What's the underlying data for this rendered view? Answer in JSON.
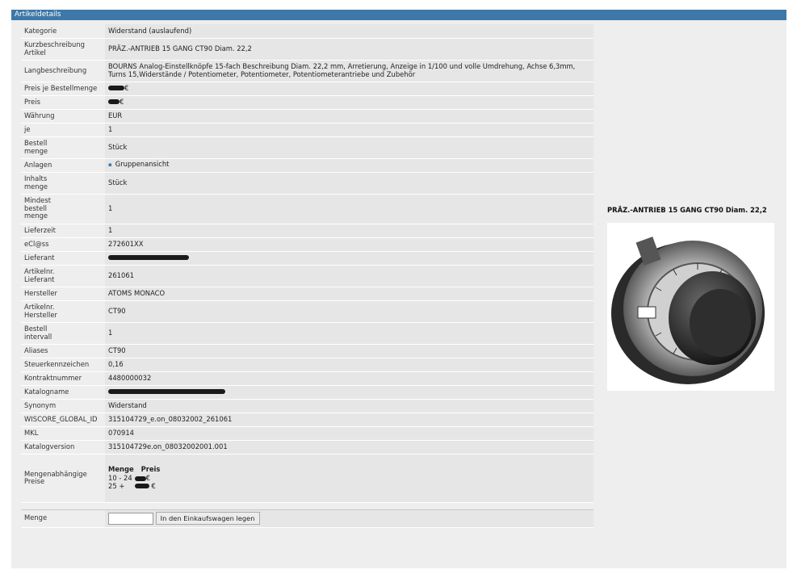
{
  "panel_title": "Artikeldetails",
  "rows": [
    {
      "label": "Kategorie",
      "value": "Widerstand (auslaufend)",
      "h": 17
    },
    {
      "label": "Kurzbeschreibung\nArtikel",
      "value": "PRÄZ.-ANTRIEB 15 GANG CT90 Diam. 22,2",
      "h": 27
    },
    {
      "label": "Langbeschreibung",
      "value": "BOURNS Analog-Einstellknöpfe 15-fach Beschreibung Diam. 22,2 mm, Arretierung, Anzeige in 1/100 und volle Umdrehung, Achse 6,3mm, Turns 15,Widerstände / Potentiometer, Potentiometer, Potentiometerantriebe und Zubehör",
      "h": 27
    },
    {
      "label": "Preis je Bestellmenge",
      "value": "€",
      "redact": "p1",
      "h": 17
    },
    {
      "label": "Preis",
      "value": "€",
      "redact": "p2",
      "h": 17
    },
    {
      "label": "Währung",
      "value": "EUR",
      "h": 17
    },
    {
      "label": "je",
      "value": "1",
      "h": 17
    },
    {
      "label": "Bestell\nmenge",
      "value": "Stück",
      "h": 27
    },
    {
      "label": "Anlagen",
      "value": "Gruppenansicht",
      "bullet": true,
      "h": 17
    },
    {
      "label": "Inhalts\nmenge",
      "value": "Stück",
      "h": 27
    },
    {
      "label": "Mindest\nbestell\nmenge",
      "value": "1",
      "h": 37
    },
    {
      "label": "Lieferzeit",
      "value": "1",
      "h": 17
    },
    {
      "label": "eCl@ss",
      "value": "272601XX",
      "h": 17
    },
    {
      "label": "Lieferant",
      "value": "",
      "redact": "long",
      "h": 17
    },
    {
      "label": "Artikelnr.\nLieferant",
      "value": "261061",
      "h": 27
    },
    {
      "label": "Hersteller",
      "value": "ATOMS MONACO",
      "h": 17
    },
    {
      "label": "Artikelnr.\nHersteller",
      "value": "CT90",
      "h": 27
    },
    {
      "label": "Bestell\nintervall",
      "value": "1",
      "h": 27
    },
    {
      "label": "Aliases",
      "value": "CT90",
      "h": 17
    },
    {
      "label": "Steuerkennzeichen",
      "value": "0,16",
      "h": 17
    },
    {
      "label": "Kontraktnummer",
      "value": "4480000032",
      "h": 17
    },
    {
      "label": "Katalogname",
      "value": "",
      "redact": "long2",
      "h": 17
    },
    {
      "label": "Synonym",
      "value": "Widerstand",
      "h": 17
    },
    {
      "label": "WISCORE_GLOBAL_ID",
      "value": "315104729_e.on_08032002_261061",
      "h": 17
    },
    {
      "label": "MKL",
      "value": "070914",
      "h": 17
    },
    {
      "label": "Katalogversion",
      "value": "315104729e.on_08032002001.001",
      "h": 17
    }
  ],
  "mengenpreise": {
    "label": "Mengenabhängige Preise",
    "head_qty": "Menge",
    "head_price": "Preis",
    "rows": [
      {
        "qty": "10 - 24",
        "value": "€",
        "redact": "p2"
      },
      {
        "qty": "25 +",
        "value": " €",
        "redact": "s"
      }
    ]
  },
  "menge": {
    "label": "Menge",
    "input_value": "",
    "button_label": "In den Einkaufswagen legen"
  },
  "product": {
    "title": "PRÄZ.-ANTRIEB 15 GANG CT90 Diam. 22,2",
    "image": "dial-knob-image"
  }
}
